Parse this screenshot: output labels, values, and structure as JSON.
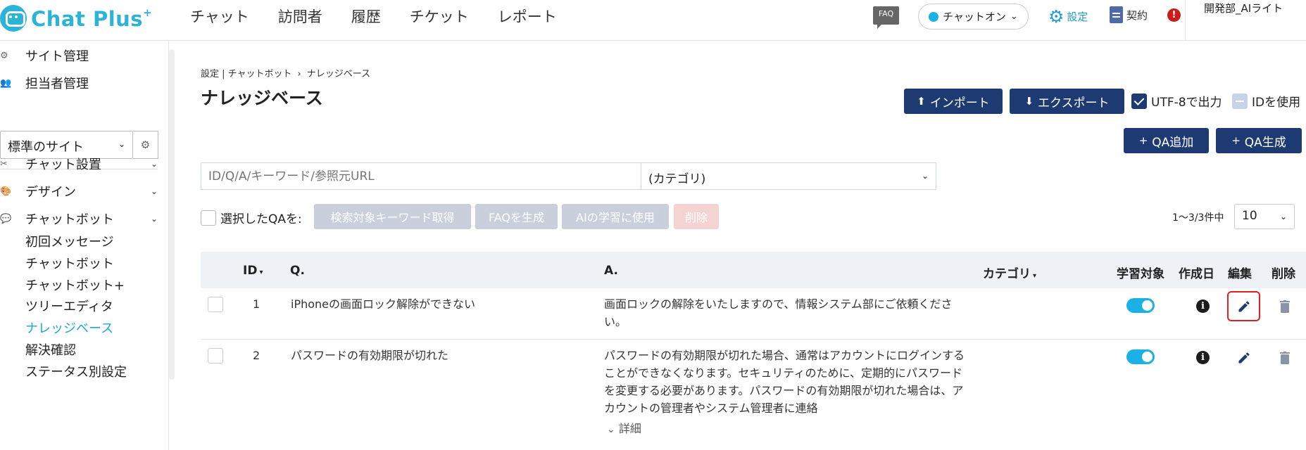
{
  "brand": {
    "name": "Chat Plus",
    "plus": "+"
  },
  "nav": {
    "items": [
      "チャット",
      "訪問者",
      "履歴",
      "チケット",
      "レポート"
    ]
  },
  "topbar": {
    "faq": "FAQ",
    "status": "チャットオン",
    "settings": "設定",
    "contract": "契約",
    "alert": "!",
    "user": "開発部_AIライト"
  },
  "sidebar": {
    "site_admin": "サイト管理",
    "staff_admin": "担当者管理",
    "site_select": "標準のサイト",
    "sections": [
      "チャット設置",
      "デザイン",
      "チャットボット"
    ],
    "sub_items": [
      "初回メッセージ",
      "チャットボット",
      "チャットボット+",
      "ツリーエディタ",
      "ナレッジベース",
      "解決確認",
      "ステータス別設定"
    ],
    "active_sub": "ナレッジベース"
  },
  "breadcrumb": {
    "parent": "設定 | チャットボット",
    "sep": "›",
    "current": "ナレッジベース"
  },
  "page_title": "ナレッジベース",
  "toolbar": {
    "import": "インポート",
    "export": "エクスポート",
    "utf8": "UTF-8で出力",
    "use_id": "IDを使用",
    "qa_add": "QA追加",
    "qa_generate": "QA生成",
    "plus": "+"
  },
  "search": {
    "placeholder": "ID/Q/A/キーワード/参照元URL",
    "category": "(カテゴリ)"
  },
  "bulk": {
    "label": "選択したQAを:",
    "keyword": "検索対象キーワード取得",
    "faq": "FAQを生成",
    "ai": "AIの学習に使用",
    "delete": "削除"
  },
  "pagination": {
    "count": "1～3/3件中",
    "per_page": "10"
  },
  "table": {
    "headers": {
      "id": "ID",
      "q": "Q.",
      "a": "A.",
      "category": "カテゴリ",
      "learn": "学習対象",
      "created": "作成日",
      "edit": "編集",
      "delete": "削除"
    },
    "rows": [
      {
        "id": "1",
        "q": "iPhoneの画面ロック解除ができない",
        "a": "画面ロックの解除をいたしますので、情報システム部にご依頼ください。",
        "learning": true
      },
      {
        "id": "2",
        "q": "パスワードの有効期限が切れた",
        "a": "パスワードの有効期限が切れた場合、通常はアカウントにログインすることができなくなります。セキュリティのために、定期的にパスワードを変更する必要があります。パスワードの有効期限が切れた場合は、アカウントの管理者やシステム管理者に連絡",
        "learning": true,
        "more": "詳細"
      }
    ]
  },
  "colors": {
    "brand": "#2bb3d8",
    "navy": "#1e3a72",
    "toggle": "#1ab2e6",
    "highlight": "#e02020"
  }
}
